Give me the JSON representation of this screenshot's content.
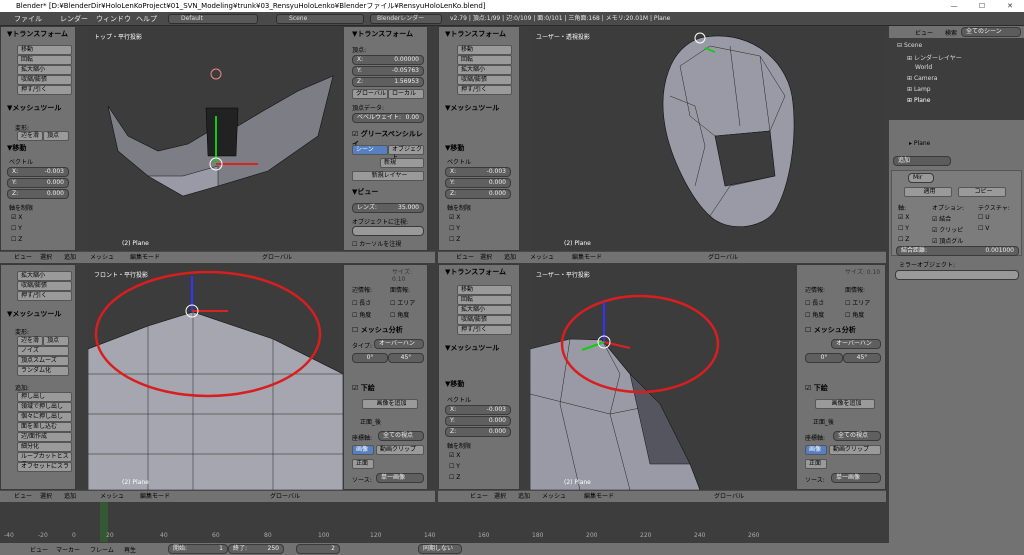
{
  "window": {
    "title": "Blender* [D:¥BlenderDir¥HoloLenKoProject¥01_SVN_Modeling¥trunk¥03_RensyuHoloLenko¥Blenderファイル¥RensyuHoloLenKo.blend]",
    "min": "—",
    "max": "☐",
    "close": "✕"
  },
  "menu": {
    "file": "ファイル",
    "render": "レンダー",
    "window": "ウィンドウ",
    "help": "ヘルプ",
    "layout": "Default",
    "scene": "Scene",
    "engine": "Blenderレンダー",
    "stats": "v2.79 | 頂点:1/99 | 辺:0/109 | 面:0/101 | 三角面:168 | メモリ:20.01M | Plane"
  },
  "tools_tl": {
    "transform": "▼トランスフォーム",
    "move": "移動",
    "rotate": "回転",
    "scale": "拡大縮小",
    "resize": "収縮/膨張",
    "push": "押す/引く",
    "mesh_tools": "▼メッシュツール",
    "deform": "変形:",
    "slide_edge": "辺を滑",
    "vertex": "頂点",
    "op_move": "▼移動",
    "vector": "ベクトル",
    "x": "X:",
    "y": "Y:",
    "z": "Z:",
    "xv": "-0.003",
    "yv": "0.000",
    "zv": "0.000",
    "constraint": "軸を制限",
    "cx": "X",
    "cy": "Y",
    "cz": "Z"
  },
  "vp_tl": {
    "label": "トップ・平行投影",
    "obj": "(2) Plane"
  },
  "vp_tr": {
    "label": "ユーザー・透視投影",
    "obj": "(2) Plane"
  },
  "vp_bl": {
    "label": "フロント・平行投影",
    "obj": "(2) Plane"
  },
  "vp_br": {
    "label": "ユーザー・平行投影",
    "obj": "(2) Plane"
  },
  "n_tl": {
    "transform": "▼トランスフォーム",
    "vertex": "頂点:",
    "x": "X:",
    "y": "Y:",
    "z": "Z:",
    "xv": "0.00000",
    "yv": "-0.05763",
    "zv": "1.56953",
    "global": "グローバル",
    "local": "ローカル",
    "vdata": "頂点データ:",
    "bevel": "ベベルウェイト:",
    "bevelv": "0.00",
    "gp": "グリースペンシルレイ",
    "sceneb": "シーン",
    "objb": "オブジェクト",
    "new": "新規",
    "newlayer": "新規レイヤー",
    "view": "▼ビュー",
    "lens": "レンズ:",
    "lensv": "35.000",
    "lockobj": "オブジェクトに注視:",
    "cursor": "カーソルを注視"
  },
  "tools_bl": {
    "scale": "拡大縮小",
    "resize": "収縮/膨張",
    "push": "押す/引く",
    "mesh_tools": "▼メッシュツール",
    "deform": "変形:",
    "slide": "辺を滑",
    "vertex": "頂点",
    "noise": "ノイズ",
    "smooth": "頂点スムーズ",
    "random": "ランダム化",
    "add": "追加:",
    "extrude": "押し出し",
    "extrude_region": "領域で押し出し",
    "extrude_ind": "個々に押し出し",
    "inset": "面を差し込む",
    "edgeadd": "辺/面作成",
    "subdiv": "細分化",
    "loopcut": "ループカットとスラ",
    "offset": "オフセットにスラ"
  },
  "n_bl": {
    "size": "サイズ: 0.10",
    "draw": "辺情報:",
    "face": "面情報:",
    "length": "長さ",
    "area": "エリア",
    "angle": "角度",
    "angle2": "角度",
    "analysis": "メッシュ分析",
    "type": "タイプ:",
    "typev": "オーバーハン",
    "deg0": "0°",
    "deg45": "45°",
    "bg": "下絵",
    "addimg": "画像を追加",
    "front": "正面_後",
    "axis": "座標軸:",
    "axisv": "全ての視点",
    "image": "画像",
    "clip": "動画クリップ",
    "frontb": "正面",
    "source": "ソース:",
    "sourcev": "単一画像"
  },
  "tools_br": {
    "transform": "▼トランスフォーム",
    "move": "移動",
    "rotate": "回転",
    "scale": "拡大縮小",
    "resize": "収縮/膨張",
    "push": "押す/引く",
    "mesh_tools": "▼メッシュツール",
    "op_move": "▼移動",
    "vector": "ベクトル",
    "x": "X:",
    "y": "Y:",
    "z": "Z:",
    "xv": "-0.003",
    "yv": "0.000",
    "zv": "0.000",
    "constraint": "軸を制限",
    "cx": "X",
    "cy": "Y",
    "cz": "Z"
  },
  "header": {
    "view": "ビュー",
    "select": "選択",
    "add": "追加",
    "mesh": "メッシュ",
    "mode": "編集モード",
    "global": "グローバル"
  },
  "outliner": {
    "view": "ビュー",
    "search": "検索",
    "filter": "全てのシーン",
    "scene": "Scene",
    "renderlayer": "レンダーレイヤー",
    "world": "World",
    "camera": "Camera",
    "lamp": "Lamp",
    "plane": "Plane"
  },
  "props": {
    "obj": "Plane",
    "add": "追加",
    "modifier": "Mir",
    "apply": "適用",
    "copy": "コピー",
    "axis": "軸:",
    "options": "オプション:",
    "texture": "テクスチャ:",
    "x": "X",
    "y": "Y",
    "z": "Z",
    "merge": "結合",
    "clip": "クリッピ",
    "vgroup": "頂点グル",
    "u": "U",
    "v": "V",
    "mergedist": "結合距離:",
    "mergev": "0.001000",
    "mirrorobj": "ミラーオブジェクト:"
  },
  "timeline": {
    "view": "ビュー",
    "marker": "マーカー",
    "frame": "フレーム",
    "play": "再生",
    "start": "開始:",
    "startv": "1",
    "end": "終了:",
    "endv": "250",
    "cur": "2",
    "sync": "同期しない",
    "ticks": [
      "-40",
      "-20",
      "0",
      "20",
      "40",
      "60",
      "80",
      "100",
      "120",
      "140",
      "160",
      "180",
      "200",
      "220",
      "240",
      "260"
    ]
  }
}
